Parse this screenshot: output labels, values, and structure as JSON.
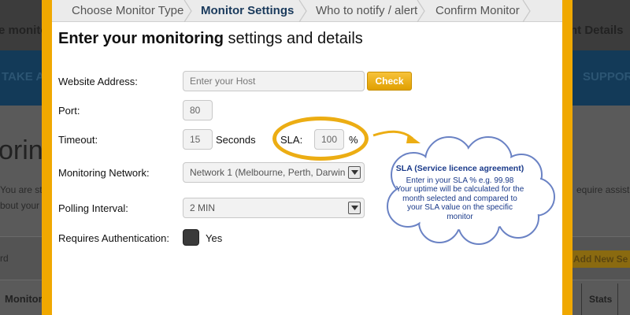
{
  "background": {
    "left_title": "e monito",
    "right_title": "nt Details",
    "left_band_text": "TAKE A",
    "right_band_text": "SUPPOR",
    "big_text": "oring",
    "para_line_1": "You are st",
    "para_line_2": "bout your",
    "right_para": "equire assista",
    "strip_text": "rd",
    "add_new_button": "Add New Se",
    "table_header_monitor": "Monitor",
    "table_header_stats": "Stats"
  },
  "wizard": {
    "steps": [
      {
        "label": "Choose Monitor Type",
        "active": false
      },
      {
        "label": "Monitor Settings",
        "active": true
      },
      {
        "label": "Who to notify / alert",
        "active": false
      },
      {
        "label": "Confirm Monitor",
        "active": false
      }
    ]
  },
  "form": {
    "heading_bold": "Enter your monitoring",
    "heading_rest": " settings and details",
    "website": {
      "label": "Website Address:",
      "placeholder": "Enter your Host",
      "check_label": "Check"
    },
    "port": {
      "label": "Port:",
      "value": "80"
    },
    "timeout": {
      "label": "Timeout:",
      "value": "15",
      "unit": "Seconds"
    },
    "sla": {
      "label": "SLA:",
      "value": "100",
      "unit": "%"
    },
    "network": {
      "label": "Monitoring Network:",
      "selected": "Network 1 (Melbourne, Perth, Darwin"
    },
    "polling": {
      "label": "Polling Interval:",
      "selected": "2 MIN"
    },
    "auth": {
      "label": "Requires Authentication:",
      "value_label": "Yes"
    }
  },
  "callout": {
    "title": "SLA (Service licence agreement)",
    "line1": "Enter in your SLA %  e.g.  99.98",
    "line2": "Your uptime will be calculated for the",
    "line3": "month selected and compared to",
    "line4": "your SLA value on the specific",
    "line5": "monitor"
  },
  "colors": {
    "accent": "#f0a800",
    "heading_blue": "#1a3a5c",
    "callout_text": "#1a3a8a"
  }
}
